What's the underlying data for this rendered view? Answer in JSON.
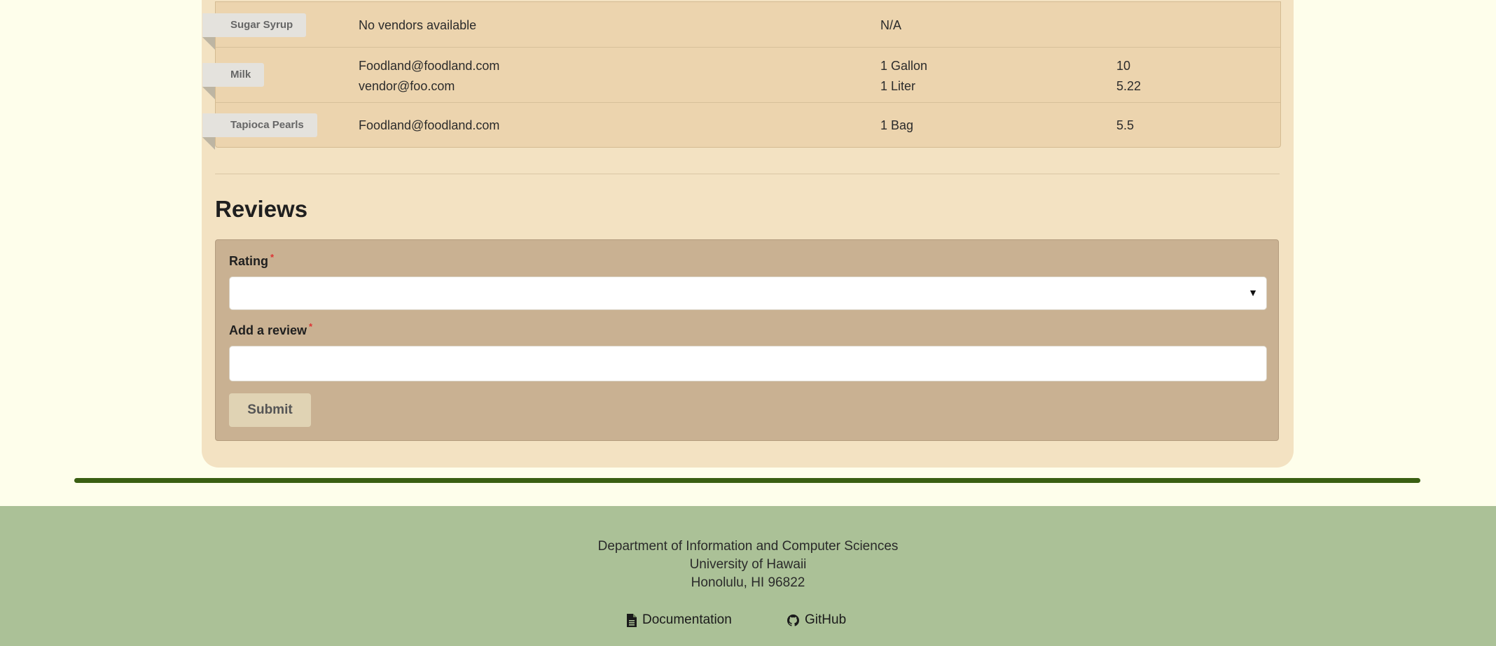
{
  "ingredients_table": {
    "rows": [
      {
        "ingredient": "Sugar Syrup",
        "vendors": [
          "No vendors available"
        ],
        "sizes": [
          "N/A"
        ],
        "prices": []
      },
      {
        "ingredient": "Milk",
        "vendors": [
          "Foodland@foodland.com",
          "vendor@foo.com"
        ],
        "sizes": [
          "1 Gallon",
          "1 Liter"
        ],
        "prices": [
          "10",
          "5.22"
        ]
      },
      {
        "ingredient": "Tapioca Pearls",
        "vendors": [
          "Foodland@foodland.com"
        ],
        "sizes": [
          "1 Bag"
        ],
        "prices": [
          "5.5"
        ]
      }
    ]
  },
  "reviews": {
    "heading": "Reviews",
    "rating_label": "Rating",
    "review_label": "Add a review",
    "required_mark": "*",
    "select_caret": "▼",
    "submit_label": "Submit"
  },
  "footer": {
    "line1": "Department of Information and Computer Sciences",
    "line2": "University of Hawaii",
    "line3": "Honolulu, HI 96822",
    "documentation_label": "Documentation",
    "github_label": "GitHub",
    "documentation_icon": "file-text-icon",
    "github_icon": "github-icon"
  },
  "colors": {
    "page_background": "#fefeeb",
    "card_background": "#f3e2c2",
    "table_background": "#ecd4ae",
    "form_background": "#c9b192",
    "accent_bar": "#3a5f12",
    "footer_background": "#abc197",
    "required": "#dd3333"
  }
}
